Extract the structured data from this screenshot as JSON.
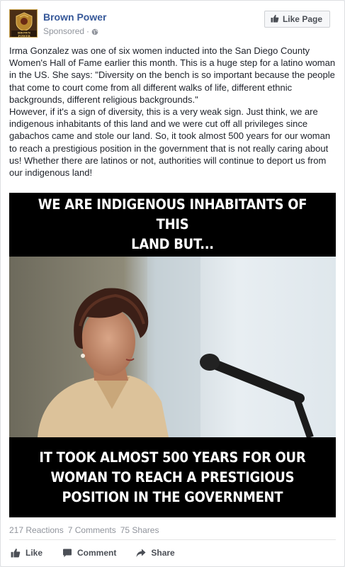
{
  "page": {
    "name": "Brown Power",
    "sponsored": "Sponsored",
    "separator": "·",
    "like_page_label": "Like Page",
    "avatar_text": [
      "BROWN",
      "POWER"
    ]
  },
  "post": {
    "paragraphs": [
      "Irma Gonzalez was one of six women inducted into the San Diego County Women's Hall of Fame earlier this month. This is a huge step for a latino woman in the US. She says: \"Diversity on the bench is so important because the people that come to court come from all different walks of life, different ethnic backgrounds, different religious backgrounds.\"",
      "However, if it's a sign of diversity, this is a very weak sign. Just think, we are indigenous inhabitants of this land and we were cut off all privileges since gabachos came and stole our land. So, it took almost 500 years for our woman to reach a prestigious position in the government that is not really caring about us! Whether there are latinos or not, authorities will continue to deport us from our indigenous land!"
    ]
  },
  "image": {
    "top_text": [
      "WE ARE INDIGENOUS INHABITANTS OF THIS",
      "LAND BUT..."
    ],
    "bottom_text": [
      "IT TOOK ALMOST 500 YEARS FOR OUR",
      "WOMAN TO REACH A PRESTIGIOUS",
      "POSITION IN THE GOVERNMENT"
    ]
  },
  "stats": {
    "reactions": "217 Reactions",
    "comments": "7 Comments",
    "shares": "75 Shares"
  },
  "actions": {
    "like": "Like",
    "comment": "Comment",
    "share": "Share"
  },
  "colors": {
    "link": "#365899",
    "meta": "#90949c",
    "action": "#4b4f56"
  },
  "icons": {
    "like_page": "thumbs-up-icon",
    "globe": "globe-icon",
    "like": "thumbs-up-icon",
    "comment": "comment-bubble-icon",
    "share": "share-arrow-icon"
  }
}
